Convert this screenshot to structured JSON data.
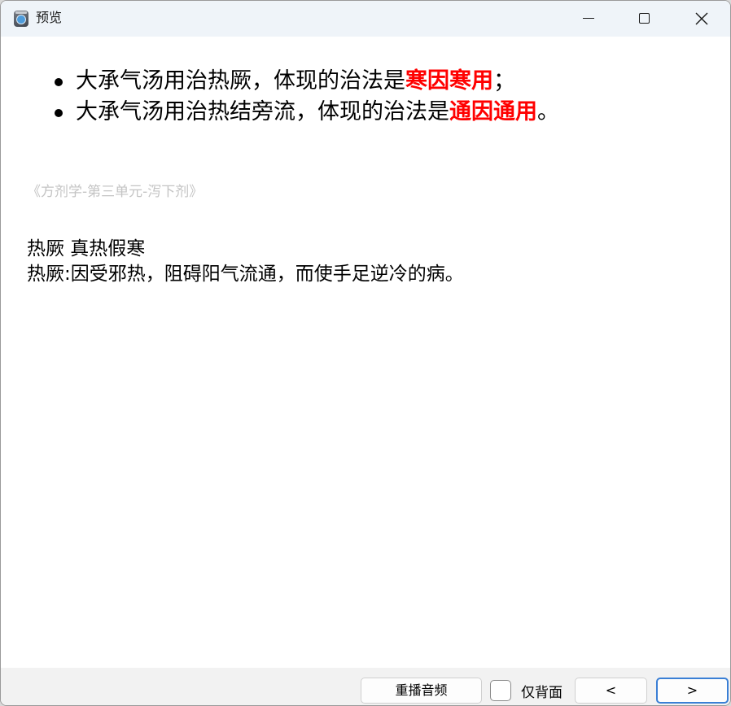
{
  "window": {
    "title": "预览"
  },
  "content": {
    "bullets": [
      {
        "prefix": "大承气汤用治热厥，体现的治法是",
        "highlight": "寒因寒用",
        "suffix": "；"
      },
      {
        "prefix": "大承气汤用治热结旁流，体现的治法是",
        "highlight": "通因通用",
        "suffix": "。"
      }
    ],
    "source": "《方剂学-第三单元-泻下剂》",
    "note_lines": [
      "热厥 真热假寒",
      "热厥:因受邪热，阻碍阳气流通，而使手足逆冷的病。"
    ]
  },
  "toolbar": {
    "replay_label": "重播音频",
    "back_only_label": "仅背面",
    "back_only_checked": false,
    "prev_label": "<",
    "next_label": ">"
  },
  "colors": {
    "highlight": "#ff0000",
    "source_text": "#c4c4c4",
    "titlebar_bg": "#eff4f9",
    "focus_border": "#3a7fd5"
  }
}
